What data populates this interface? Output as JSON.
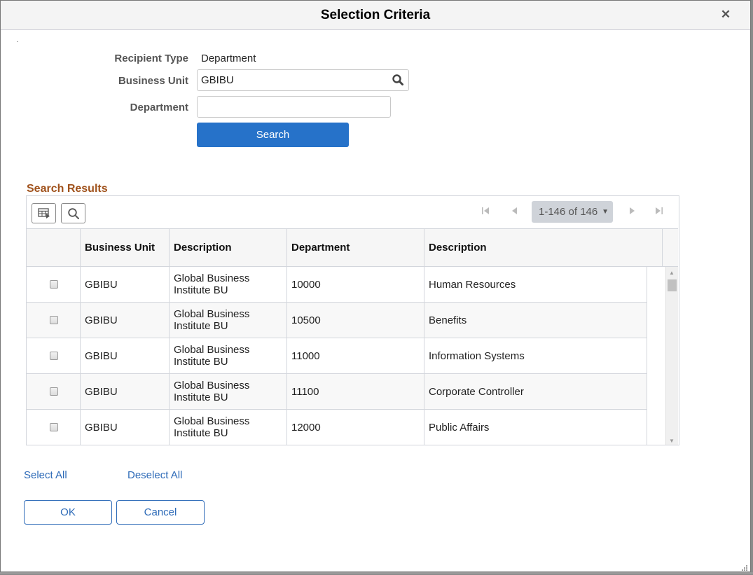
{
  "dialog": {
    "title": "Selection Criteria",
    "close_icon": "close-icon"
  },
  "form": {
    "recipient_type_label": "Recipient Type",
    "recipient_type_value": "Department",
    "business_unit_label": "Business Unit",
    "business_unit_value": "GBIBU",
    "department_label": "Department",
    "department_value": "",
    "search_button": "Search"
  },
  "results": {
    "section_title": "Search Results",
    "toolbar": {
      "personalize_icon": "grid-personalize-icon",
      "find_icon": "search-icon"
    },
    "pager": {
      "range_label": "1-146 of 146",
      "first_icon": "first-page-icon",
      "prev_icon": "previous-page-icon",
      "next_icon": "next-page-icon",
      "last_icon": "last-page-icon"
    },
    "columns": [
      "",
      "Business Unit",
      "Description",
      "Department",
      "Description"
    ],
    "rows": [
      {
        "checked": false,
        "business_unit": "GBIBU",
        "bu_description": "Global Business Institute BU",
        "department": "10000",
        "description": "Human Resources"
      },
      {
        "checked": false,
        "business_unit": "GBIBU",
        "bu_description": "Global Business Institute BU",
        "department": "10500",
        "description": "Benefits"
      },
      {
        "checked": false,
        "business_unit": "GBIBU",
        "bu_description": "Global Business Institute BU",
        "department": "11000",
        "description": "Information Systems"
      },
      {
        "checked": false,
        "business_unit": "GBIBU",
        "bu_description": "Global Business Institute BU",
        "department": "11100",
        "description": "Corporate Controller"
      },
      {
        "checked": false,
        "business_unit": "GBIBU",
        "bu_description": "Global Business Institute BU",
        "department": "12000",
        "description": "Public Affairs"
      }
    ]
  },
  "actions": {
    "select_all": "Select All",
    "deselect_all": "Deselect All",
    "ok": "OK",
    "cancel": "Cancel"
  },
  "colors": {
    "primary": "#2672c9",
    "link": "#2e6bb8",
    "section_title": "#a0521c"
  }
}
